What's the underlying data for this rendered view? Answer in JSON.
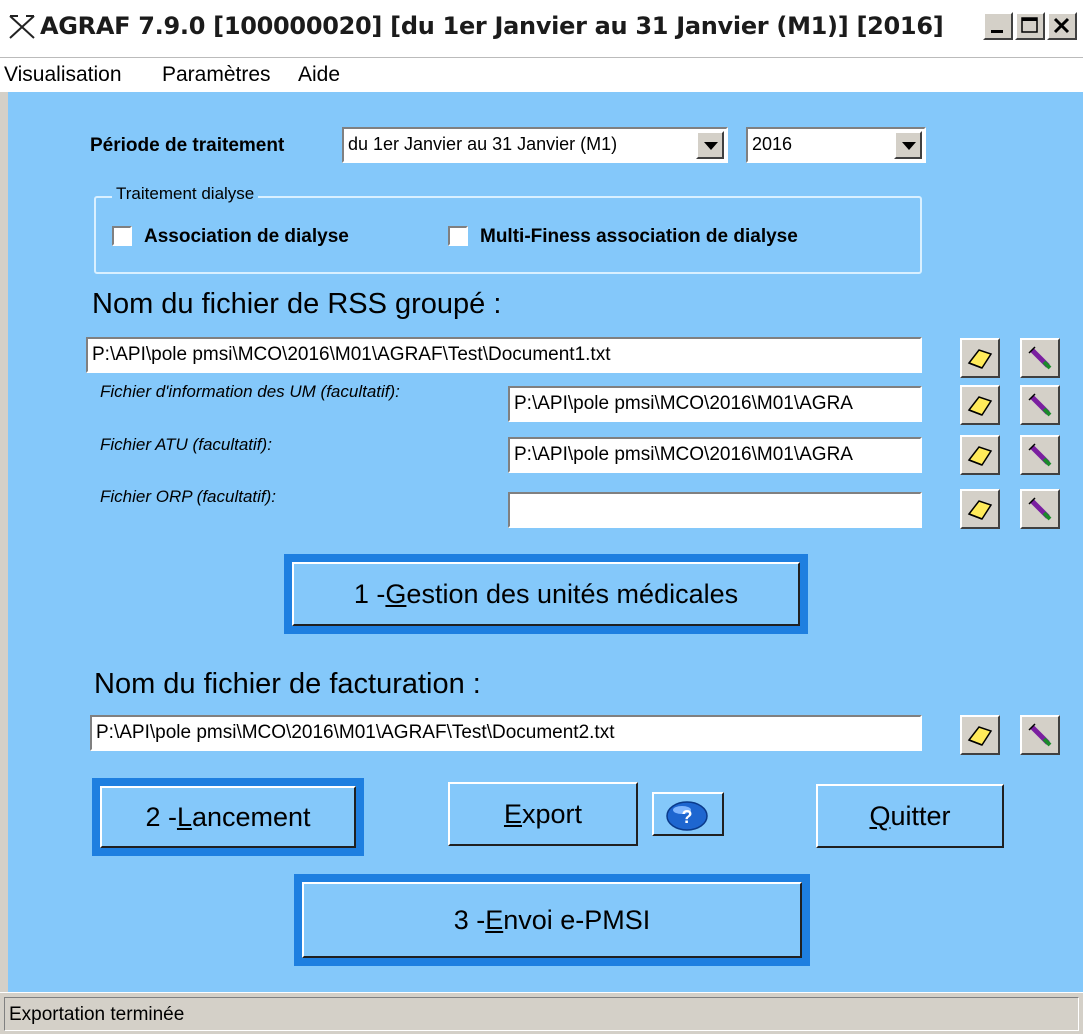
{
  "window": {
    "title": "AGRAF 7.9.0 [100000020] [du 1er Janvier au 31 Janvier (M1)] [2016]",
    "app_icon": "agraf-cross-icon"
  },
  "menu": [
    "Visualisation",
    "Paramètres",
    "Aide"
  ],
  "periode": {
    "label": "Période de traitement",
    "period_value": "du 1er Janvier au 31 Janvier (M1)",
    "year_value": "2016"
  },
  "dialyse": {
    "group_label": "Traitement dialyse",
    "association_label": "Association de dialyse",
    "association_checked": false,
    "multi_label": "Multi-Finess association de dialyse",
    "multi_checked": false
  },
  "rss": {
    "heading": "Nom du fichier de RSS groupé :",
    "file_value": "P:\\API\\pole pmsi\\MCO\\2016\\M01\\AGRAF\\Test\\Document1.txt",
    "um_label": "Fichier d'information des UM (facultatif):",
    "um_value": "P:\\API\\pole pmsi\\MCO\\2016\\M01\\AGRA",
    "atu_label": "Fichier ATU (facultatif):",
    "atu_value": "P:\\API\\pole pmsi\\MCO\\2016\\M01\\AGRA",
    "orp_label": "Fichier ORP (facultatif):",
    "orp_value": ""
  },
  "buttons": {
    "gestion_prefix": "1 - ",
    "gestion_hot": "G",
    "gestion_rest": "estion des unités médicales",
    "lancement_prefix": "2 - ",
    "lancement_hot": "L",
    "lancement_rest": "ancement",
    "export_hot": "E",
    "export_rest": "xport",
    "help_icon": "help-question-icon",
    "quitter_hot": "Q",
    "quitter_rest": "uitter",
    "envoi_prefix": "3 - ",
    "envoi_hot": "E",
    "envoi_rest": "nvoi e-PMSI"
  },
  "facturation": {
    "heading": "Nom du fichier de facturation :",
    "file_value": "P:\\API\\pole pmsi\\MCO\\2016\\M01\\AGRAF\\Test\\Document2.txt"
  },
  "status": {
    "text": "Exportation terminée"
  },
  "icons": {
    "browse": "eraser-browse-icon",
    "clear": "pen-clear-icon"
  },
  "colors": {
    "client_bg": "#84c8fa",
    "focus_ring": "#1e7fe0",
    "chrome": "#d4d0c8"
  }
}
